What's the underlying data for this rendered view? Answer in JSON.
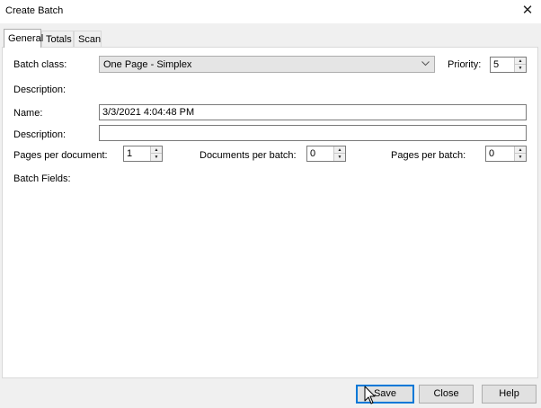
{
  "window": {
    "title": "Create Batch",
    "close_glyph": "✕"
  },
  "tabs": [
    "General",
    "Totals",
    "Scan"
  ],
  "form": {
    "batch_class_label": "Batch class:",
    "batch_class_value": "One Page - Simplex",
    "priority_label": "Priority:",
    "priority_value": "5",
    "class_description_label": "Description:",
    "name_label": "Name:",
    "name_value": "3/3/2021 4:04:48 PM",
    "description_label": "Description:",
    "description_value": "",
    "pages_per_document_label": "Pages per document:",
    "pages_per_document_value": "1",
    "documents_per_batch_label": "Documents per batch:",
    "documents_per_batch_value": "0",
    "pages_per_batch_label": "Pages per batch:",
    "pages_per_batch_value": "0",
    "batch_fields_label": "Batch Fields:"
  },
  "buttons": {
    "save": "Save",
    "close": "Close",
    "help": "Help"
  },
  "icons": {
    "dropdown": "chevron-down-icon",
    "spin_up": "arrow-up-icon",
    "spin_down": "arrow-down-icon",
    "cursor": "mouse-pointer-icon"
  },
  "colors": {
    "default_button_border": "#0078d7",
    "window_bg": "#f0f0f0",
    "panel_bg": "#ffffff"
  }
}
